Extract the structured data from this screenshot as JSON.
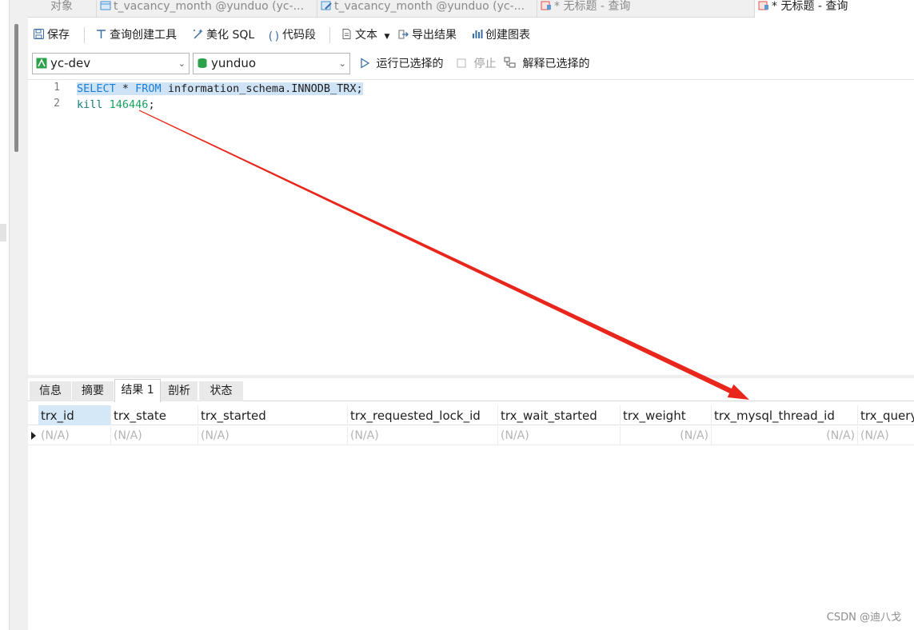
{
  "tabs": [
    {
      "label": "对象"
    },
    {
      "label": "t_vacancy_month @yunduo (yc-..."
    },
    {
      "label": "t_vacancy_month @yunduo (yc-..."
    },
    {
      "label": "* 无标题 - 查询"
    },
    {
      "label": "* 无标题 - 查询"
    }
  ],
  "toolbar": {
    "save": "保存",
    "query_builder": "查询创建工具",
    "beautify": "美化 SQL",
    "snippet": "代码段",
    "text": "文本",
    "export": "导出结果",
    "create_chart": "创建图表"
  },
  "toolbar2": {
    "connection": "yc-dev",
    "database": "yunduo",
    "run_selected": "运行已选择的",
    "stop": "停止",
    "explain_selected": "解释已选择的"
  },
  "editor": {
    "line_numbers": [
      "1",
      "2"
    ],
    "line1": {
      "kw1": "SELECT",
      "mid": " * ",
      "kw2": "FROM",
      "rest": " information_schema.INNODB_TRX;"
    },
    "line2": {
      "cmd": "kill",
      "num": "146446",
      "end": ";"
    }
  },
  "result_tabs": [
    "信息",
    "摘要",
    "结果 1",
    "剖析",
    "状态"
  ],
  "grid": {
    "columns": [
      "trx_id",
      "trx_state",
      "trx_started",
      "trx_requested_lock_id",
      "trx_wait_started",
      "trx_weight",
      "trx_mysql_thread_id",
      "trx_query"
    ],
    "rows": [
      [
        "(N/A)",
        "(N/A)",
        "(N/A)",
        "(N/A)",
        "(N/A)",
        "(N/A)",
        "(N/A)",
        "(N/A)"
      ]
    ]
  },
  "watermark": "CSDN @迪八戈",
  "colors": {
    "annotation_arrow": "#e8261b",
    "keyword": "#1a7fd6",
    "number": "#19a15e",
    "selection": "#cfe3f7"
  }
}
